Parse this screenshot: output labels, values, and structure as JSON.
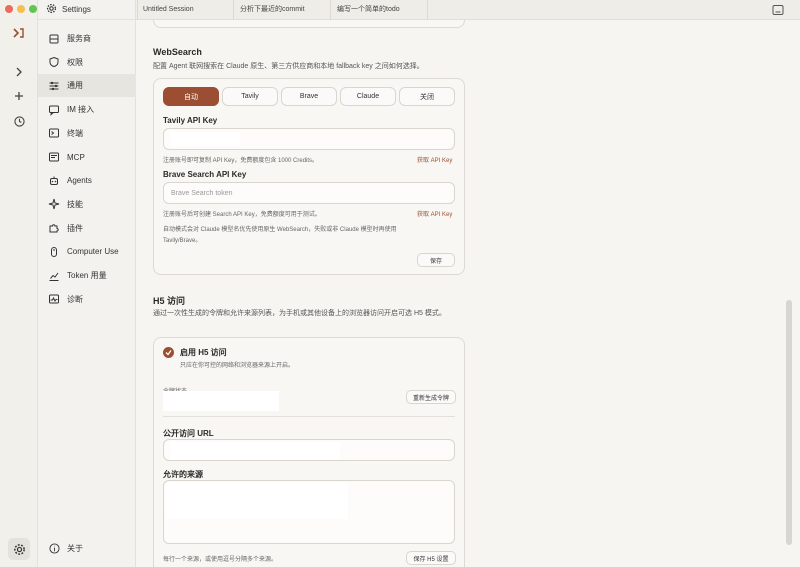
{
  "window": {
    "traffic": [
      "#ed6a5e",
      "#f5bf4f",
      "#61c554"
    ]
  },
  "sidebar": {
    "title": "Settings",
    "items": [
      {
        "label": "服务商",
        "icon": "server-icon"
      },
      {
        "label": "权限",
        "icon": "shield-icon"
      },
      {
        "label": "通用",
        "icon": "sliders-icon"
      },
      {
        "label": "IM 接入",
        "icon": "chat-icon"
      },
      {
        "label": "终端",
        "icon": "terminal-icon"
      },
      {
        "label": "MCP",
        "icon": "mcp-icon"
      },
      {
        "label": "Agents",
        "icon": "robot-icon"
      },
      {
        "label": "技能",
        "icon": "sparkle-icon"
      },
      {
        "label": "插件",
        "icon": "puzzle-icon"
      },
      {
        "label": "Computer Use",
        "icon": "mouse-icon"
      },
      {
        "label": "Token 用量",
        "icon": "chart-icon"
      },
      {
        "label": "诊断",
        "icon": "diagnostics-icon"
      }
    ],
    "about": "关于"
  },
  "tabs": [
    "Untitled Session",
    "分析下最近的commit",
    "编写一个简单的todo"
  ],
  "websearch": {
    "title": "WebSearch",
    "desc": "配置 Agent 联网搜索在 Claude 原生、第三方供应商和本地 fallback key 之间如何选择。",
    "options": [
      "自动",
      "Tavily",
      "Brave",
      "Claude",
      "关闭"
    ],
    "tavily_label": "Tavily API Key",
    "tavily_hint": "注册账号即可复制 API Key，免费额度包含 1000 Credits。",
    "tavily_link": "获取 API Key",
    "brave_label": "Brave Search API Key",
    "brave_placeholder": "Brave Search token",
    "brave_hint": "注册账号后可创建 Search API Key，免费额度可用于测试。",
    "brave_link": "获取 API Key",
    "note": "自动模式会对 Claude 模型名优先使用原生 WebSearch，失败或非 Claude 模型时再使用 Tavily/Brave。",
    "save": "保存"
  },
  "h5": {
    "title": "H5 访问",
    "desc": "通过一次性生成的令牌和允许来源列表，为手机或其他设备上的浏览器访问开启可选 H5 模式。",
    "enable_label": "启用 H5 访问",
    "enable_hint": "只应在你可控的网络和浏览器来源上开启。",
    "token_label": "令牌状态",
    "regen": "重新生成令牌",
    "url_label": "公开访问 URL",
    "origins_label": "允许的来源",
    "origins_hint": "每行一个来源，或使用逗号分隔多个来源。",
    "save": "保存 H5 设置"
  },
  "colors": {
    "accent": "#9b4e32"
  }
}
